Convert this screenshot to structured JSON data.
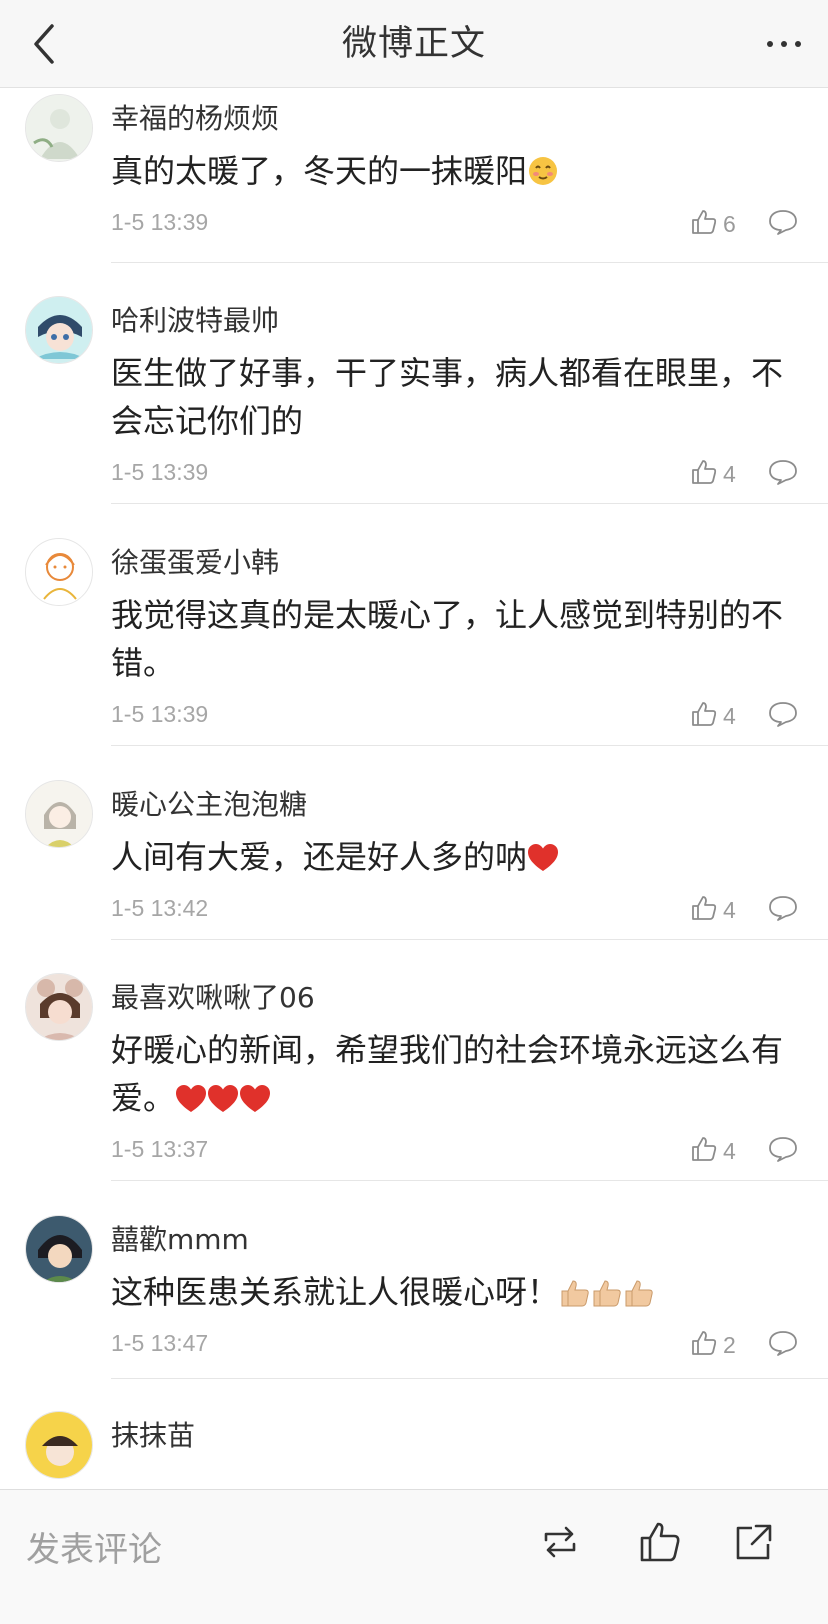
{
  "header": {
    "title": "微博正文"
  },
  "comments": [
    {
      "username": "幸福的杨烦烦",
      "text": "真的太暖了，冬天的一抹暖阳",
      "time": "1-5 13:39",
      "likes": "6"
    },
    {
      "username": "哈利波特最帅",
      "text": "医生做了好事，干了实事，病人都看在眼里，不会忘记你们的",
      "time": "1-5 13:39",
      "likes": "4"
    },
    {
      "username": "徐蛋蛋爱小韩",
      "text": "我觉得这真的是太暖心了，让人感觉到特别的不错。",
      "time": "1-5 13:39",
      "likes": "4"
    },
    {
      "username": "暖心公主泡泡糖",
      "text": "人间有大爱，还是好人多的呐",
      "time": "1-5 13:42",
      "likes": "4"
    },
    {
      "username": "最喜欢啾啾了06",
      "text": "好暖心的新闻，希望我们的社会环境永远这么有爱。",
      "time": "1-5 13:37",
      "likes": "4"
    },
    {
      "username": "囍歡mmm",
      "text": "这种医患关系就让人很暖心呀！",
      "time": "1-5 13:47",
      "likes": "2"
    },
    {
      "username": "抹抹苗"
    }
  ],
  "bottom_bar": {
    "comment_placeholder": "发表评论"
  },
  "colors": {
    "heart": "#e0312b",
    "text_primary": "#222222",
    "text_muted": "#a6a6a6",
    "navbar_bg": "#f7f7f7"
  },
  "icons": [
    "back-icon",
    "more-icon",
    "like-icon",
    "reply-icon",
    "repost-icon",
    "thumbs-up-icon",
    "share-icon"
  ]
}
